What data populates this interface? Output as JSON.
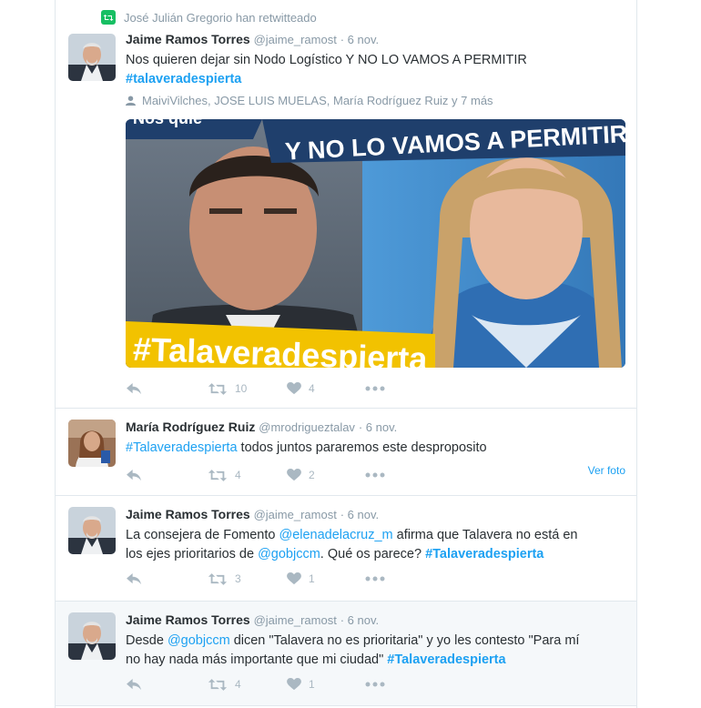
{
  "colors": {
    "link": "#1da1f2",
    "meta": "#8899a6",
    "action": "#aab8c2",
    "retweet": "#17bf63"
  },
  "tweets": [
    {
      "context": "José Julián Gregorio han retwitteado",
      "name": "Jaime Ramos Torres",
      "handle": "@jaime_ramost",
      "time": "· 6 nov.",
      "text1": "Nos quieren dejar sin Nodo Logístico Y NO LO VAMOS A PERMITIR",
      "tag": "#talaveradespierta",
      "social": "MaiviVilches, JOSE LUIS MUELAS, María Rodríguez Ruiz y 7 más",
      "image_banner": "Y NO LO VAMOS A PERMITIR",
      "image_top": "Nos quie",
      "image_hashtag": "#Talaveradespierta",
      "retweets": "10",
      "likes": "4"
    },
    {
      "name": "María Rodríguez Ruiz",
      "handle": "@mrodrigueztalav",
      "time": "· 6 nov.",
      "tag": "#Talaveradespierta",
      "text": " todos juntos pararemos este desproposito",
      "retweets": "4",
      "likes": "2",
      "ver_foto": "Ver foto"
    },
    {
      "name": "Jaime Ramos Torres",
      "handle": "@jaime_ramost",
      "time": "· 6 nov.",
      "t1": "La consejera de Fomento ",
      "mention1": "@elenadelacruz_m",
      "t2": " afirma que Talavera no está en",
      "t3": "los ejes prioritarios de ",
      "mention2": "@gobjccm",
      "t4": ". Qué os parece? ",
      "tag": "#Talaveradespierta",
      "retweets": "3",
      "likes": "1"
    },
    {
      "name": "Jaime Ramos Torres",
      "handle": "@jaime_ramost",
      "time": "· 6 nov.",
      "t1": "Desde ",
      "mention1": "@gobjccm",
      "t2": " dicen \"Talavera no es prioritaria\" y yo les contesto \"Para mí",
      "t3": "no hay nada más importante que mi ciudad\" ",
      "tag": "#Talaveradespierta",
      "retweets": "4",
      "likes": "1"
    }
  ]
}
